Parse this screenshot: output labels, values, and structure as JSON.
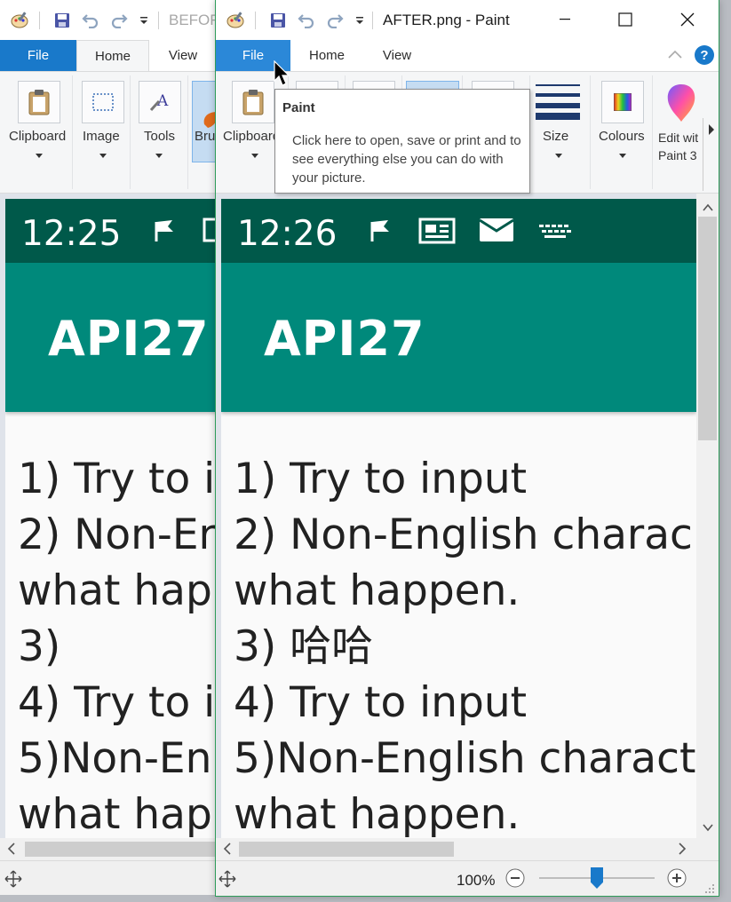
{
  "before_window": {
    "title": "BEFOR",
    "tabs": {
      "file": "File",
      "home": "Home",
      "view": "View"
    },
    "ribbon": {
      "clipboard": "Clipboard",
      "image": "Image",
      "tools": "Tools",
      "brushes": "Bru"
    },
    "phone": {
      "time": "12:25",
      "app_title": "API27",
      "lines": [
        "1) Try to i",
        "2) Non-Er",
        "what hap",
        "3)",
        "4) Try to i",
        "5)Non-En",
        "what hap"
      ]
    }
  },
  "after_window": {
    "title": "AFTER.png - Paint",
    "tabs": {
      "file": "File",
      "home": "Home",
      "view": "View"
    },
    "ribbon": {
      "clipboard": "Clipboard",
      "size": "Size",
      "colours": "Colours",
      "edit_paint3d_line1": "Edit wit",
      "edit_paint3d_line2": "Paint 3"
    },
    "phone": {
      "time": "12:26",
      "app_title": "API27",
      "lines": [
        "1) Try to input",
        "2) Non-English charac",
        "what happen.",
        "3) 哈哈",
        "4) Try to input",
        "5)Non-English charact",
        "what happen."
      ]
    },
    "zoom": "100%"
  },
  "tooltip": {
    "title": "Paint",
    "body": "Click here to open, save or print and to see everything else you can do with your picture."
  },
  "colors": {
    "file_tab": "#1979ca",
    "status_bar": "#00594a",
    "app_bar": "#00897b",
    "window_border": "#2e9c5a"
  }
}
